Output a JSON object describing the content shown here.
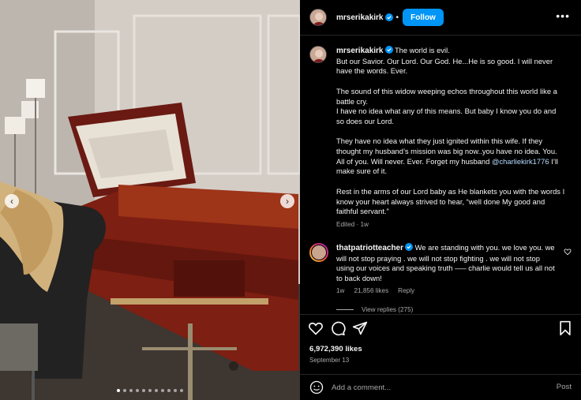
{
  "colors": {
    "background": "#000000",
    "accent_blue": "#0095f6",
    "muted_text": "#a8a8a8",
    "mention": "#b3dbff"
  },
  "media": {
    "carousel_dots": 11,
    "active_dot": 0,
    "prev_icon": "chevron-left-icon",
    "next_icon": "chevron-right-icon"
  },
  "header": {
    "username": "mrserikakirk",
    "separator": "•",
    "follow_label": "Follow",
    "more_icon": "more-horizontal-icon"
  },
  "caption": {
    "username": "mrserikakirk",
    "lines": [
      "The world is evil.",
      "But our Savior. Our Lord. Our God. He...He is so good. I will never have the words. Ever.",
      "The sound of this widow weeping echos throughout this world like a battle cry.",
      "I have no idea what any of this means. But baby I know you do and so does our Lord.",
      "They have no idea what they just ignited within this wife. If they thought my husband’s mission was big now..you have no idea. You. All of you. Will never. Ever. Forget my husband",
      "@charliekirk1776",
      "I’ll make sure of it.",
      "Rest in the arms of our Lord baby as He blankets you with the words I know your heart always strived to hear, “well done My good and faithful servant.”"
    ],
    "meta": "Edited · 1w"
  },
  "comment": {
    "username": "thatpatriotteacher",
    "text": "We are standing with you. we love you. we will not stop praying . we will not stop fighting . we will not stop using our voices and speaking truth —– charlie would tell us all not to back down!",
    "age": "1w",
    "likes": "21,856 likes",
    "reply": "Reply",
    "view_replies": "View replies (275)"
  },
  "actions": {
    "like_icon": "heart-icon",
    "comment_icon": "comment-icon",
    "share_icon": "share-icon",
    "save_icon": "bookmark-icon"
  },
  "stats": {
    "likes": "6,972,390 likes",
    "date": "September 13"
  },
  "add_comment": {
    "placeholder": "Add a comment...",
    "post_label": "Post",
    "emoji_icon": "emoji-icon"
  }
}
